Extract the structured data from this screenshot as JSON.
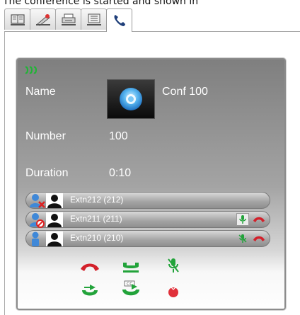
{
  "caption": "The conference is started and shown in",
  "tabs": [
    {
      "icon": "book-icon",
      "active": false
    },
    {
      "icon": "pen-icon",
      "active": false
    },
    {
      "icon": "print-icon",
      "active": false
    },
    {
      "icon": "list-icon",
      "active": false
    },
    {
      "icon": "phone-icon",
      "active": true
    }
  ],
  "conference": {
    "name_label": "Name",
    "name_value": "Conf 100",
    "number_label": "Number",
    "number_value": "100",
    "duration_label": "Duration",
    "duration_value": "0:10"
  },
  "participants": [
    {
      "name": "Extn212 (212)",
      "status_icon": "user-declined-icon"
    },
    {
      "name": "Extn211 (211)",
      "status_icon": "user-blocked-icon"
    },
    {
      "name": "Extn210 (210)",
      "status_icon": "user-icon"
    }
  ],
  "controls": [
    {
      "icon": "hangup-icon"
    },
    {
      "icon": "hold-icon"
    },
    {
      "icon": "mute-icon"
    },
    {
      "icon": "transfer-icon"
    },
    {
      "icon": "conference-transfer-icon"
    },
    {
      "icon": "record-icon"
    }
  ],
  "colors": {
    "accent_green": "#22a33a",
    "hangup_red": "#d3202a",
    "record_red": "#e0303a",
    "card_gray": "#8c8c8c"
  }
}
